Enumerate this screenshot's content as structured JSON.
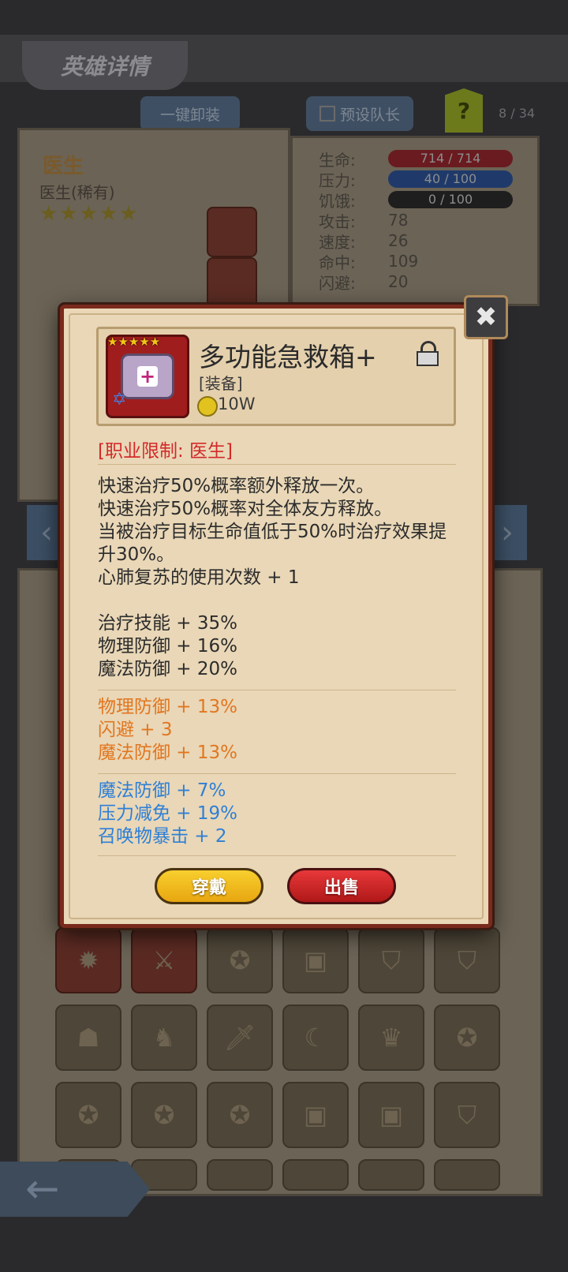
{
  "background": {
    "title": "英雄详情",
    "unequip_all_label": "一键卸装",
    "preset_leader_label": "预设队长",
    "help_label": "?",
    "hero_count": "8 / 34",
    "hero_name": "医生",
    "hero_class": "医生(稀有)",
    "stars": "★★★★★",
    "stats": [
      {
        "name": "生命:",
        "value": "714 / 714"
      },
      {
        "name": "压力:",
        "value": "40 / 100"
      },
      {
        "name": "饥饿:",
        "value": "0 / 100"
      },
      {
        "name": "攻击:",
        "value": "78"
      },
      {
        "name": "速度:",
        "value": "26"
      },
      {
        "name": "命中:",
        "value": "109"
      },
      {
        "name": "闪避:",
        "value": "20"
      }
    ]
  },
  "item": {
    "name": "多功能急救箱+",
    "type": "[装备]",
    "price": "10W",
    "stars": "★★★★★",
    "icon": "first-aid-kit-icon",
    "locked": false
  },
  "restriction": "[职业限制: 医生]",
  "effects": [
    "快速治疗50%概率额外释放一次。",
    "快速治疗50%概率对全体友方释放。",
    "当被治疗目标生命值低于50%时治疗效果提升30%。",
    "心肺复苏的使用次数 + 1"
  ],
  "base_stats": [
    "治疗技能 + 35%",
    "物理防御 + 16%",
    "魔法防御 + 20%"
  ],
  "orange_stats": [
    "物理防御 + 13%",
    "闪避 + 3",
    "魔法防御 + 13%"
  ],
  "blue_stats": [
    "魔法防御 + 7%",
    "压力减免 + 19%",
    "召唤物暴击 + 2"
  ],
  "buttons": {
    "wear": "穿戴",
    "sell": "出售"
  },
  "colors": {
    "restriction": "#d42a2a",
    "orange_stat": "#e27620",
    "blue_stat": "#2f7fd6",
    "wear_button": "#f2c11f",
    "sell_button": "#d42424"
  }
}
